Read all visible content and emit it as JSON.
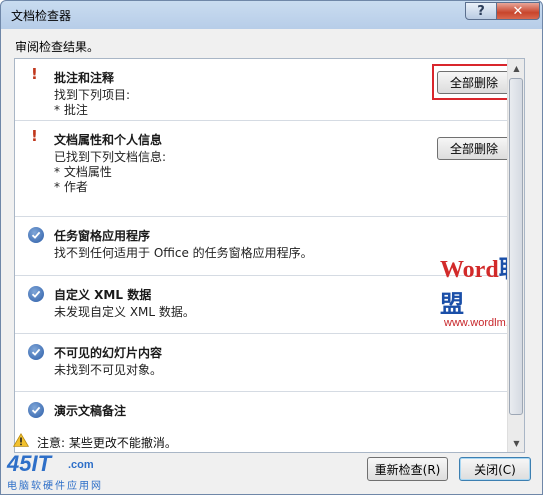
{
  "window": {
    "title": "文档检查器"
  },
  "titlebar": {
    "help_label": "?",
    "close_label": "✕"
  },
  "result_title": "审阅检查结果。",
  "sections": [
    {
      "status": "warning",
      "title": "批注和注释",
      "lines": [
        "找到下列项目:",
        "* 批注"
      ],
      "button": "全部删除",
      "highlighted": true
    },
    {
      "status": "warning",
      "title": "文档属性和个人信息",
      "lines": [
        "已找到下列文档信息:",
        "* 文档属性",
        "* 作者"
      ],
      "button": "全部删除",
      "highlighted": false
    },
    {
      "status": "ok",
      "title": "任务窗格应用程序",
      "lines": [
        "找不到任何适用于 Office 的任务窗格应用程序。"
      ]
    },
    {
      "status": "ok",
      "title": "自定义 XML 数据",
      "lines": [
        "未发现自定义 XML 数据。"
      ]
    },
    {
      "status": "ok",
      "title": "不可见的幻灯片内容",
      "lines": [
        "未找到不可见对象。"
      ]
    },
    {
      "status": "ok",
      "title": "演示文稿备注",
      "lines": []
    }
  ],
  "watermark": {
    "word": "Word",
    "cn": "联盟",
    "url": "www.wordlm.com"
  },
  "footer": {
    "warning_text": "注意: 某些更改不能撤消。",
    "reinspect_label": "重新检查(R)",
    "close_label": "关闭(C)"
  },
  "logo": {
    "main": "45IT",
    "com": ".com",
    "sub": "电脑软硬件应用网"
  },
  "colors": {
    "warning": "#c0371c",
    "check": "#2d5ea8",
    "highlight": "#d9262c"
  },
  "icons": {
    "warning": "exclamation-icon",
    "ok": "check-circle-icon",
    "footer": "warning-triangle-icon"
  }
}
